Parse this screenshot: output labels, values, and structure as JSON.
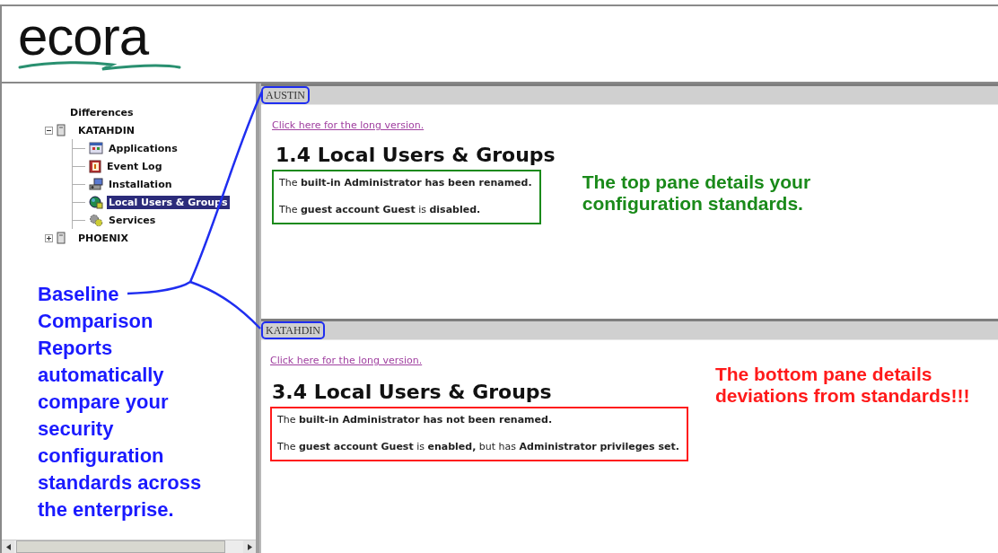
{
  "logo": {
    "text": "ecora"
  },
  "tree": {
    "label": "Differences",
    "children": [
      {
        "label": "KATAHDIN",
        "expanded": true,
        "children": [
          {
            "label": "Applications",
            "kind": "applications",
            "selected": false
          },
          {
            "label": "Event Log",
            "kind": "event_log",
            "selected": false
          },
          {
            "label": "Installation",
            "kind": "installation",
            "selected": false
          },
          {
            "label": "Local Users & Groups",
            "kind": "users",
            "selected": true
          },
          {
            "label": "Services",
            "kind": "services",
            "selected": false
          }
        ]
      },
      {
        "label": "PHOENIX",
        "expanded": false
      }
    ]
  },
  "sidebar_note": {
    "lines": [
      "Baseline",
      "Comparison",
      "Reports",
      "automatically",
      "compare your",
      "security",
      "configuration",
      "standards across",
      "the enterprise."
    ]
  },
  "panes": [
    {
      "host": "AUSTIN",
      "link": "Click here for the long version.",
      "heading": "1.4 Local Users & Groups",
      "color": "#1a8a1a",
      "findings": [
        "The **built-in Administrator has been renamed.**",
        "The **guest account Guest** is **disabled.**"
      ],
      "note_lines": [
        "The top pane details your",
        "configuration standards."
      ]
    },
    {
      "host": "KATAHDIN",
      "link": "Click here for the long version.",
      "heading": "3.4 Local Users & Groups",
      "color": "#ff1a1a",
      "findings": [
        "The **built-in Administrator has not been renamed.**",
        "The **guest account Guest** is **enabled,** but has **Administrator privileges set.**"
      ],
      "note_lines": [
        "The bottom pane details",
        "deviations from standards!!!"
      ]
    }
  ]
}
